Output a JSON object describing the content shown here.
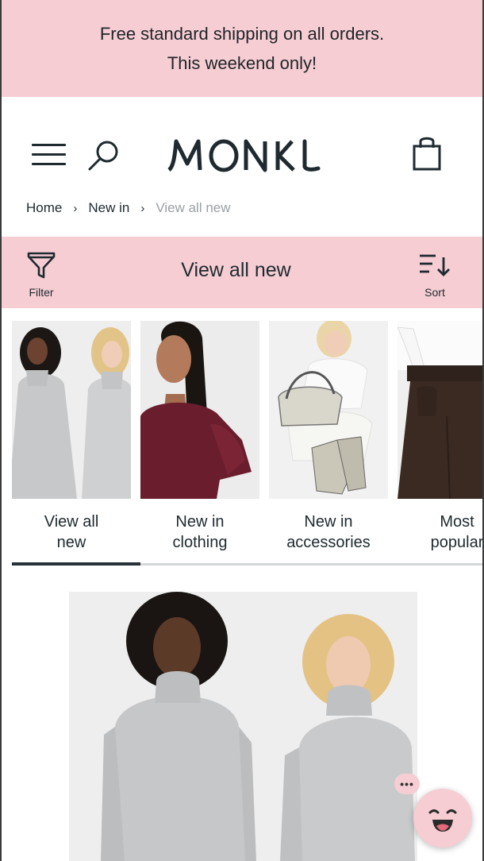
{
  "promo": {
    "line1": "Free standard shipping on all orders.",
    "line2": "This weekend only!"
  },
  "header": {
    "brand": "MONKI",
    "icons": [
      "menu-icon",
      "search-icon",
      "logo",
      "shopping-bag-icon"
    ]
  },
  "breadcrumb": {
    "items": [
      "Home",
      "New in",
      "View all new"
    ],
    "separator": "›"
  },
  "titlebar": {
    "title": "View all new",
    "filter_label": "Filter",
    "sort_label": "Sort"
  },
  "categories": [
    {
      "label": "View all\nnew",
      "active": true
    },
    {
      "label": "New in\nclothing",
      "active": false
    },
    {
      "label": "New in\naccessories",
      "active": false
    },
    {
      "label": "Most\npopular",
      "active": false
    }
  ],
  "chat": {
    "dots": "•••",
    "icon": "smiley-face-icon"
  },
  "colors": {
    "accent_pink": "#f5cdd3",
    "text_dark": "#1e2a30",
    "muted": "#9aa0a4"
  }
}
